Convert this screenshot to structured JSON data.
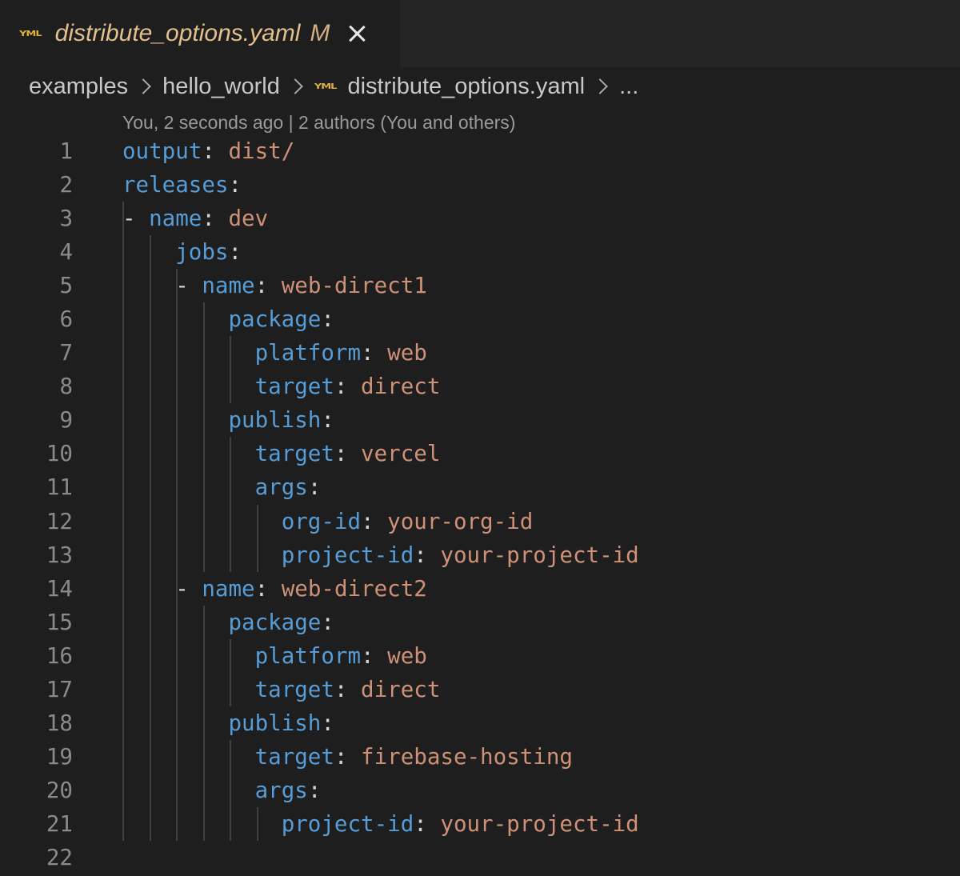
{
  "tab": {
    "filename": "distribute_options.yaml",
    "status": "M",
    "icon": "yaml-icon"
  },
  "breadcrumb": {
    "items": [
      "examples",
      "hello_world",
      "distribute_options.yaml",
      "..."
    ]
  },
  "blame": "You, 2 seconds ago | 2 authors (You and others)",
  "colors": {
    "key": "#569cd6",
    "value": "#ce9178",
    "tab_modified": "#e2c08d",
    "background": "#1e1e1e"
  },
  "lines": [
    {
      "num": "1",
      "indent": 0,
      "dash": false,
      "key": "output",
      "value": "dist/"
    },
    {
      "num": "2",
      "indent": 0,
      "dash": false,
      "key": "releases",
      "value": ""
    },
    {
      "num": "3",
      "indent": 1,
      "dash": true,
      "key": "name",
      "value": "dev"
    },
    {
      "num": "4",
      "indent": 2,
      "dash": false,
      "key": "jobs",
      "value": ""
    },
    {
      "num": "5",
      "indent": 3,
      "dash": true,
      "key": "name",
      "value": "web-direct1"
    },
    {
      "num": "6",
      "indent": 4,
      "dash": false,
      "key": "package",
      "value": ""
    },
    {
      "num": "7",
      "indent": 5,
      "dash": false,
      "key": "platform",
      "value": "web"
    },
    {
      "num": "8",
      "indent": 5,
      "dash": false,
      "key": "target",
      "value": "direct"
    },
    {
      "num": "9",
      "indent": 4,
      "dash": false,
      "key": "publish",
      "value": ""
    },
    {
      "num": "10",
      "indent": 5,
      "dash": false,
      "key": "target",
      "value": "vercel"
    },
    {
      "num": "11",
      "indent": 5,
      "dash": false,
      "key": "args",
      "value": ""
    },
    {
      "num": "12",
      "indent": 6,
      "dash": false,
      "key": "org-id",
      "value": "your-org-id"
    },
    {
      "num": "13",
      "indent": 6,
      "dash": false,
      "key": "project-id",
      "value": "your-project-id"
    },
    {
      "num": "14",
      "indent": 3,
      "dash": true,
      "key": "name",
      "value": "web-direct2"
    },
    {
      "num": "15",
      "indent": 4,
      "dash": false,
      "key": "package",
      "value": ""
    },
    {
      "num": "16",
      "indent": 5,
      "dash": false,
      "key": "platform",
      "value": "web"
    },
    {
      "num": "17",
      "indent": 5,
      "dash": false,
      "key": "target",
      "value": "direct"
    },
    {
      "num": "18",
      "indent": 4,
      "dash": false,
      "key": "publish",
      "value": ""
    },
    {
      "num": "19",
      "indent": 5,
      "dash": false,
      "key": "target",
      "value": "firebase-hosting"
    },
    {
      "num": "20",
      "indent": 5,
      "dash": false,
      "key": "args",
      "value": ""
    },
    {
      "num": "21",
      "indent": 6,
      "dash": false,
      "key": "project-id",
      "value": "your-project-id"
    },
    {
      "num": "22",
      "indent": 0,
      "dash": false,
      "key": "",
      "value": ""
    }
  ]
}
